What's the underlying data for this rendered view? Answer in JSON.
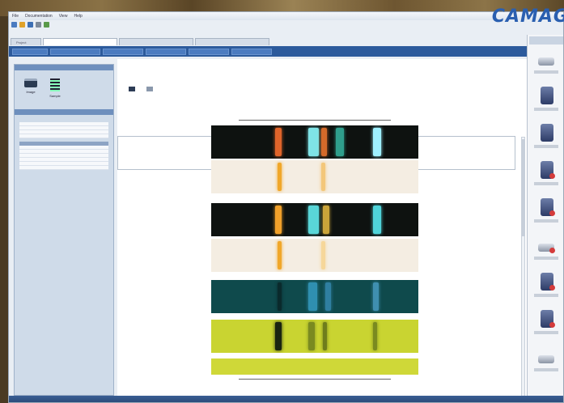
{
  "brand": {
    "logo_text": "CAMAG"
  },
  "titlebar": {
    "menu": [
      "File",
      "Documentation",
      "View",
      "Help"
    ]
  },
  "toolbar": {
    "text": ""
  },
  "doc_tabs": [
    "Project",
    "",
    "",
    ""
  ],
  "ribbon": {
    "buttons": [
      "",
      "",
      "",
      "",
      "",
      ""
    ]
  },
  "left_panel": {
    "views_header": "",
    "views": [
      {
        "label": "Image",
        "icon": "image-icon"
      },
      {
        "label": "Sample",
        "icon": "sample-icon"
      }
    ],
    "table_header": "",
    "columns": [
      "",
      "",
      ""
    ],
    "rows": [
      [
        "",
        "",
        ""
      ],
      [
        "",
        "",
        ""
      ],
      [
        "",
        "",
        ""
      ],
      [
        "",
        "",
        ""
      ]
    ],
    "section_label": "",
    "rows2": [
      [
        "",
        "",
        ""
      ],
      [
        "",
        "",
        ""
      ],
      [
        "",
        "",
        ""
      ],
      [
        "",
        "",
        ""
      ],
      [
        "",
        "",
        ""
      ],
      [
        "",
        "",
        ""
      ]
    ]
  },
  "actions": [
    {
      "label": "",
      "icon": "capture-icon"
    },
    {
      "label": "",
      "icon": "compare-icon"
    }
  ],
  "ruler_ticks": [
    "",
    "",
    "",
    "",
    "",
    "",
    "",
    "",
    ""
  ],
  "strips": [
    {
      "bg": "#0e1210",
      "bands": [
        {
          "pos": 0.31,
          "w": 0.03,
          "color": "#e0642a"
        },
        {
          "pos": 0.47,
          "w": 0.05,
          "color": "#7fe3e6"
        },
        {
          "pos": 0.53,
          "w": 0.03,
          "color": "#d46a2a"
        },
        {
          "pos": 0.6,
          "w": 0.04,
          "color": "#2f9e8c"
        },
        {
          "pos": 0.78,
          "w": 0.04,
          "color": "#9ff0ff"
        }
      ]
    },
    {
      "bg": "#f4ede2",
      "bands": [
        {
          "pos": 0.32,
          "w": 0.02,
          "color": "#f0a72a"
        },
        {
          "pos": 0.53,
          "w": 0.02,
          "color": "#f3c77a"
        }
      ]
    },
    {
      "bg": "#0e1210",
      "bands": [
        {
          "pos": 0.31,
          "w": 0.03,
          "color": "#f0a02a"
        },
        {
          "pos": 0.47,
          "w": 0.05,
          "color": "#59d6d8"
        },
        {
          "pos": 0.54,
          "w": 0.03,
          "color": "#caa43a"
        },
        {
          "pos": 0.78,
          "w": 0.04,
          "color": "#4fd3d9"
        }
      ]
    },
    {
      "bg": "#f4ede2",
      "bands": [
        {
          "pos": 0.32,
          "w": 0.02,
          "color": "#f0a72a"
        },
        {
          "pos": 0.53,
          "w": 0.02,
          "color": "#f6d79a"
        }
      ]
    },
    {
      "bg": "#0f4a4c",
      "bands": [
        {
          "pos": 0.32,
          "w": 0.02,
          "color": "#0a2a2c"
        },
        {
          "pos": 0.47,
          "w": 0.04,
          "color": "#2f8fb0"
        },
        {
          "pos": 0.55,
          "w": 0.03,
          "color": "#2f7fa0"
        },
        {
          "pos": 0.78,
          "w": 0.03,
          "color": "#3f8fb0"
        }
      ]
    },
    {
      "bg": "#c9d431",
      "bands": [
        {
          "pos": 0.31,
          "w": 0.03,
          "color": "#1a2410"
        },
        {
          "pos": 0.47,
          "w": 0.03,
          "color": "#7a8a20"
        },
        {
          "pos": 0.54,
          "w": 0.02,
          "color": "#6f7d1c"
        },
        {
          "pos": 0.78,
          "w": 0.02,
          "color": "#7a8a20"
        }
      ]
    },
    {
      "bg": "#cfd838",
      "bands": []
    }
  ],
  "status": {
    "left": "",
    "right": ""
  },
  "colors": {
    "accent": "#2c5a9c",
    "logo": "#2a5fb0"
  }
}
